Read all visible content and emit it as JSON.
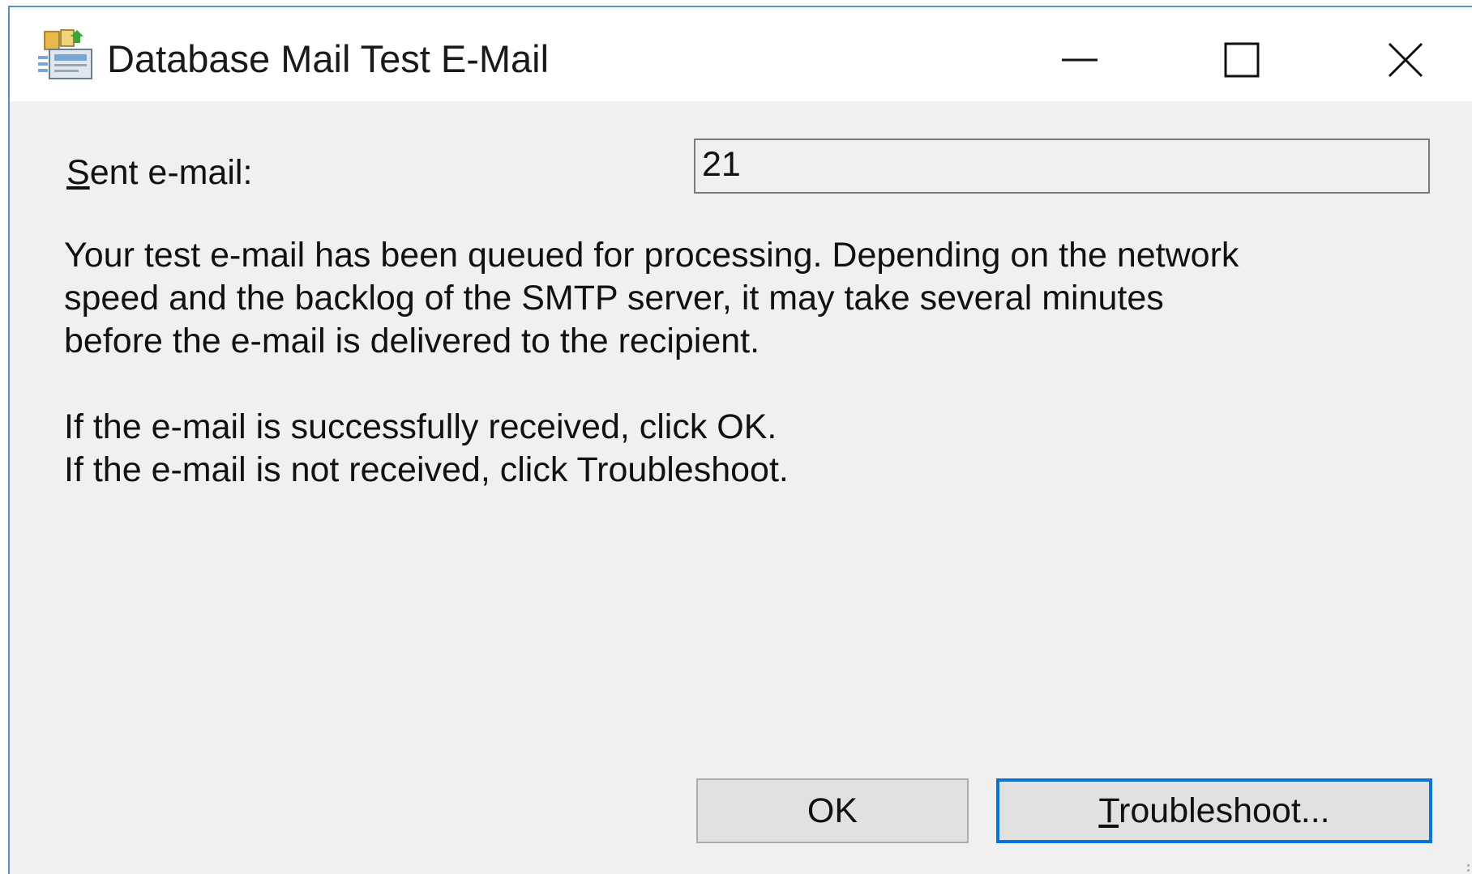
{
  "window": {
    "title": "Database Mail Test E-Mail",
    "icon": "database-mail-icon",
    "controls": {
      "minimize": "minimize-icon",
      "maximize": "maximize-icon",
      "close": "close-icon"
    }
  },
  "form": {
    "sent_label_mnemonic": "S",
    "sent_label_rest": "ent e-mail:",
    "sent_value": "21"
  },
  "message": {
    "line1": "Your test e-mail has been queued for processing.  Depending on the network",
    "line2": "speed and the backlog of the SMTP server, it may take several minutes",
    "line3": "before the e-mail is delivered to the recipient.",
    "line4": "If the e-mail is successfully received, click OK.",
    "line5": "If the e-mail is not received, click Troubleshoot."
  },
  "buttons": {
    "ok": "OK",
    "troubleshoot_mnemonic": "T",
    "troubleshoot_rest": "roubleshoot..."
  },
  "colors": {
    "dialog_bg": "#f0f0f0",
    "titlebar_bg": "#ffffff",
    "focus_border": "#0a73d6",
    "window_border": "#5a8fc4"
  }
}
